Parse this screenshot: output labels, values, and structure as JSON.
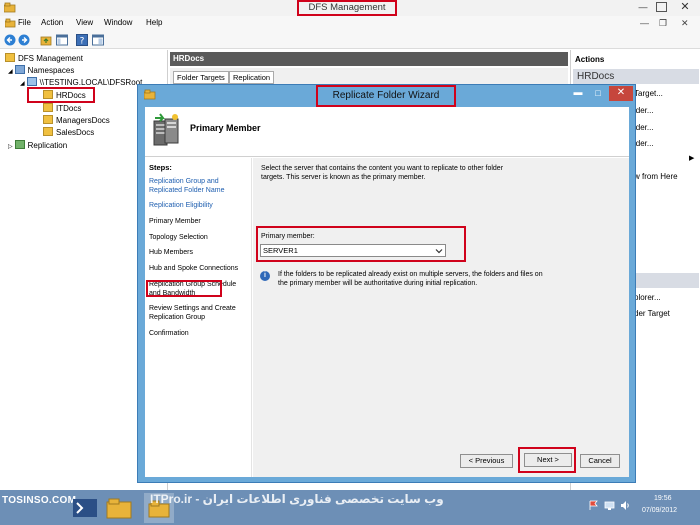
{
  "window": {
    "title": "DFS Management",
    "min_glyph": "—",
    "close_glyph": "✕"
  },
  "menu": {
    "items": [
      "File",
      "Action",
      "View",
      "Window",
      "Help"
    ],
    "right_min": "—",
    "right_restore": "❐",
    "right_close": "✕"
  },
  "tree": {
    "root": "DFS Management",
    "namespaces": "Namespaces",
    "namespace_root": "\\\\TESTING.LOCAL\\DFSRoot",
    "folders": [
      "HRDocs",
      "ITDocs",
      "ManagersDocs",
      "SalesDocs"
    ],
    "replication": "Replication"
  },
  "middle": {
    "header": "HRDocs",
    "tabs": [
      "Folder Targets",
      "Replication"
    ]
  },
  "actions": {
    "title": "Actions",
    "section1": "HRDocs",
    "items1": [
      "Target...",
      "lder...",
      "lder...",
      "lder...",
      "w from Here"
    ],
    "section2": "tDocs",
    "items2": [
      "plorer...",
      "der Target"
    ],
    "arrow_glyph": "▶"
  },
  "wizard": {
    "title": "Replicate Folder Wizard",
    "header_title": "Primary Member",
    "steps_title": "Steps:",
    "steps": [
      "Replication Group and Replicated Folder Name",
      "Replication Eligibility",
      "Primary Member",
      "Topology Selection",
      "Hub Members",
      "Hub and Spoke Connections",
      "Replication Group Schedule and Bandwidth",
      "Review Settings and Create Replication Group",
      "Confirmation"
    ],
    "description": "Select the server that contains the content you want to replicate to other folder targets. This server is known as the primary member.",
    "primary_member_label": "Primary member:",
    "primary_member_value": "SERVER1",
    "info_glyph": "i",
    "info_text": "If the folders to be replicated already exist on multiple servers, the folders and files on the primary member will be authoritative during initial replication.",
    "buttons": {
      "previous": "< Previous",
      "next": "Next >",
      "cancel": "Cancel"
    },
    "controls": {
      "min": "▬",
      "max": "□",
      "close": "✕"
    }
  },
  "taskbar": {
    "brand": "TOSINSO.COM",
    "watermark": "ITPro.ir - وب سایت تخصصی فناوری اطلاعات ایران",
    "time": "19:56",
    "date": "07/09/2012"
  },
  "colors": {
    "highlight": "#d0021b",
    "wizard_frame": "#6aa9d8",
    "taskbar": "#6d8fb6",
    "link": "#1f5fb0"
  }
}
